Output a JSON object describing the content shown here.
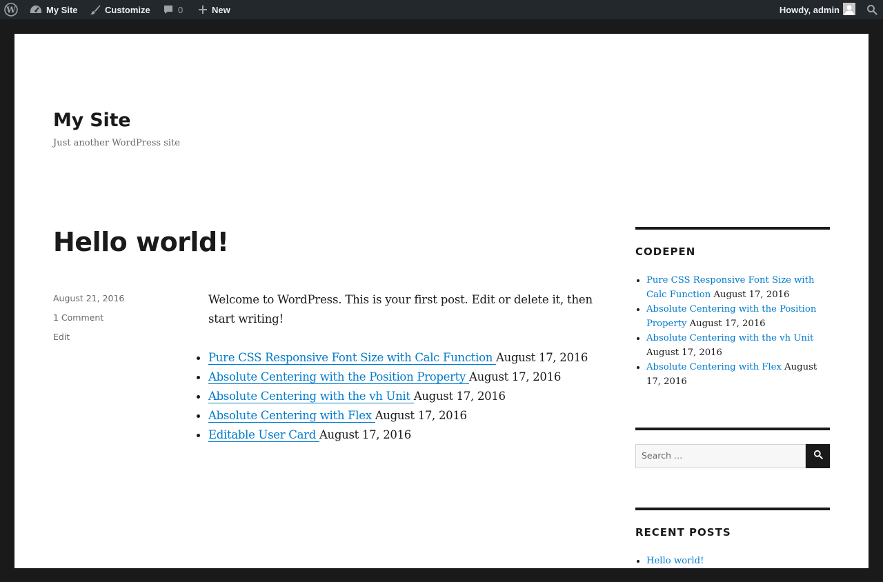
{
  "admin_bar": {
    "icons": {
      "wp": "wordpress-logo-icon",
      "site": "dashboard-icon",
      "customize": "paintbrush-icon",
      "comments": "comment-bubble-icon",
      "new": "plus-icon",
      "avatar": "user-avatar-icon",
      "search": "search-icon"
    },
    "my_site": "My Site",
    "customize": "Customize",
    "comments_count": "0",
    "new": "New",
    "howdy": "Howdy, admin"
  },
  "site": {
    "title": "My Site",
    "description": "Just another WordPress site"
  },
  "post": {
    "title": "Hello world!",
    "date": "August 21, 2016",
    "comments": "1 Comment",
    "edit": "Edit",
    "intro": "Welcome to WordPress. This is your first post. Edit or delete it, then start writing!",
    "list": [
      {
        "title": "Pure CSS Responsive Font Size with Calc Function ",
        "date": "August 17, 2016"
      },
      {
        "title": "Absolute Centering with the Position Property ",
        "date": "August 17, 2016"
      },
      {
        "title": "Absolute Centering with the vh Unit ",
        "date": "August 17, 2016"
      },
      {
        "title": "Absolute Centering with Flex ",
        "date": "August 17, 2016"
      },
      {
        "title": "Editable User Card ",
        "date": "August 17, 2016"
      }
    ]
  },
  "sidebar": {
    "codepen": {
      "title": "CODEPEN",
      "items": [
        {
          "title": "Pure CSS Responsive Font Size with Calc Function",
          "date": "August 17, 2016"
        },
        {
          "title": "Absolute Centering with the Position Property",
          "date": "August 17, 2016"
        },
        {
          "title": "Absolute Centering with the vh Unit",
          "date": "August 17, 2016"
        },
        {
          "title": "Absolute Centering with Flex",
          "date": "August 17, 2016"
        }
      ]
    },
    "search": {
      "placeholder": "Search …",
      "icon": "search-icon"
    },
    "recent": {
      "title": "RECENT POSTS",
      "items": [
        {
          "title": "Hello world!"
        }
      ]
    }
  },
  "colors": {
    "link": "#007acc",
    "admin_bar": "#23282d",
    "text": "#1a1a1a"
  }
}
